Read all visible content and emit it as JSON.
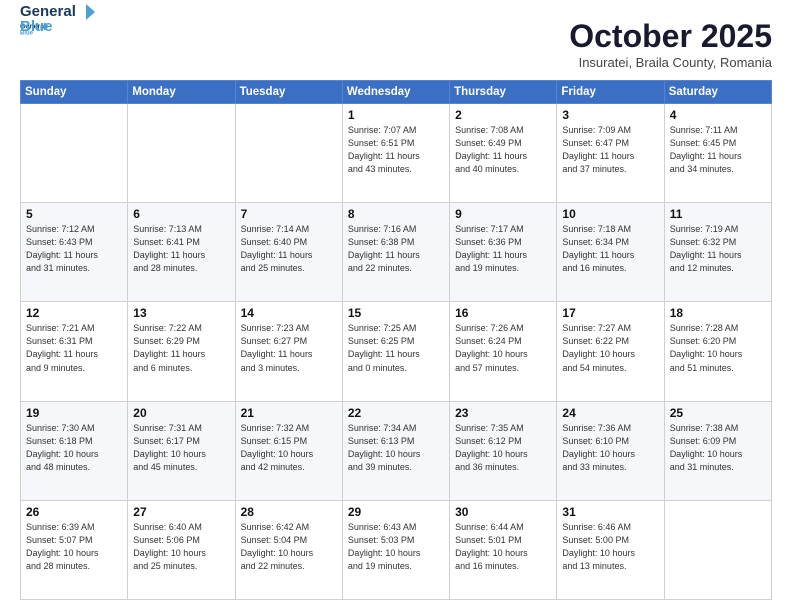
{
  "header": {
    "logo_line1": "General",
    "logo_line2": "Blue",
    "month": "October 2025",
    "location": "Insuratei, Braila County, Romania"
  },
  "days_of_week": [
    "Sunday",
    "Monday",
    "Tuesday",
    "Wednesday",
    "Thursday",
    "Friday",
    "Saturday"
  ],
  "weeks": [
    [
      {
        "day": "",
        "info": ""
      },
      {
        "day": "",
        "info": ""
      },
      {
        "day": "",
        "info": ""
      },
      {
        "day": "1",
        "info": "Sunrise: 7:07 AM\nSunset: 6:51 PM\nDaylight: 11 hours\nand 43 minutes."
      },
      {
        "day": "2",
        "info": "Sunrise: 7:08 AM\nSunset: 6:49 PM\nDaylight: 11 hours\nand 40 minutes."
      },
      {
        "day": "3",
        "info": "Sunrise: 7:09 AM\nSunset: 6:47 PM\nDaylight: 11 hours\nand 37 minutes."
      },
      {
        "day": "4",
        "info": "Sunrise: 7:11 AM\nSunset: 6:45 PM\nDaylight: 11 hours\nand 34 minutes."
      }
    ],
    [
      {
        "day": "5",
        "info": "Sunrise: 7:12 AM\nSunset: 6:43 PM\nDaylight: 11 hours\nand 31 minutes."
      },
      {
        "day": "6",
        "info": "Sunrise: 7:13 AM\nSunset: 6:41 PM\nDaylight: 11 hours\nand 28 minutes."
      },
      {
        "day": "7",
        "info": "Sunrise: 7:14 AM\nSunset: 6:40 PM\nDaylight: 11 hours\nand 25 minutes."
      },
      {
        "day": "8",
        "info": "Sunrise: 7:16 AM\nSunset: 6:38 PM\nDaylight: 11 hours\nand 22 minutes."
      },
      {
        "day": "9",
        "info": "Sunrise: 7:17 AM\nSunset: 6:36 PM\nDaylight: 11 hours\nand 19 minutes."
      },
      {
        "day": "10",
        "info": "Sunrise: 7:18 AM\nSunset: 6:34 PM\nDaylight: 11 hours\nand 16 minutes."
      },
      {
        "day": "11",
        "info": "Sunrise: 7:19 AM\nSunset: 6:32 PM\nDaylight: 11 hours\nand 12 minutes."
      }
    ],
    [
      {
        "day": "12",
        "info": "Sunrise: 7:21 AM\nSunset: 6:31 PM\nDaylight: 11 hours\nand 9 minutes."
      },
      {
        "day": "13",
        "info": "Sunrise: 7:22 AM\nSunset: 6:29 PM\nDaylight: 11 hours\nand 6 minutes."
      },
      {
        "day": "14",
        "info": "Sunrise: 7:23 AM\nSunset: 6:27 PM\nDaylight: 11 hours\nand 3 minutes."
      },
      {
        "day": "15",
        "info": "Sunrise: 7:25 AM\nSunset: 6:25 PM\nDaylight: 11 hours\nand 0 minutes."
      },
      {
        "day": "16",
        "info": "Sunrise: 7:26 AM\nSunset: 6:24 PM\nDaylight: 10 hours\nand 57 minutes."
      },
      {
        "day": "17",
        "info": "Sunrise: 7:27 AM\nSunset: 6:22 PM\nDaylight: 10 hours\nand 54 minutes."
      },
      {
        "day": "18",
        "info": "Sunrise: 7:28 AM\nSunset: 6:20 PM\nDaylight: 10 hours\nand 51 minutes."
      }
    ],
    [
      {
        "day": "19",
        "info": "Sunrise: 7:30 AM\nSunset: 6:18 PM\nDaylight: 10 hours\nand 48 minutes."
      },
      {
        "day": "20",
        "info": "Sunrise: 7:31 AM\nSunset: 6:17 PM\nDaylight: 10 hours\nand 45 minutes."
      },
      {
        "day": "21",
        "info": "Sunrise: 7:32 AM\nSunset: 6:15 PM\nDaylight: 10 hours\nand 42 minutes."
      },
      {
        "day": "22",
        "info": "Sunrise: 7:34 AM\nSunset: 6:13 PM\nDaylight: 10 hours\nand 39 minutes."
      },
      {
        "day": "23",
        "info": "Sunrise: 7:35 AM\nSunset: 6:12 PM\nDaylight: 10 hours\nand 36 minutes."
      },
      {
        "day": "24",
        "info": "Sunrise: 7:36 AM\nSunset: 6:10 PM\nDaylight: 10 hours\nand 33 minutes."
      },
      {
        "day": "25",
        "info": "Sunrise: 7:38 AM\nSunset: 6:09 PM\nDaylight: 10 hours\nand 31 minutes."
      }
    ],
    [
      {
        "day": "26",
        "info": "Sunrise: 6:39 AM\nSunset: 5:07 PM\nDaylight: 10 hours\nand 28 minutes."
      },
      {
        "day": "27",
        "info": "Sunrise: 6:40 AM\nSunset: 5:06 PM\nDaylight: 10 hours\nand 25 minutes."
      },
      {
        "day": "28",
        "info": "Sunrise: 6:42 AM\nSunset: 5:04 PM\nDaylight: 10 hours\nand 22 minutes."
      },
      {
        "day": "29",
        "info": "Sunrise: 6:43 AM\nSunset: 5:03 PM\nDaylight: 10 hours\nand 19 minutes."
      },
      {
        "day": "30",
        "info": "Sunrise: 6:44 AM\nSunset: 5:01 PM\nDaylight: 10 hours\nand 16 minutes."
      },
      {
        "day": "31",
        "info": "Sunrise: 6:46 AM\nSunset: 5:00 PM\nDaylight: 10 hours\nand 13 minutes."
      },
      {
        "day": "",
        "info": ""
      }
    ]
  ]
}
